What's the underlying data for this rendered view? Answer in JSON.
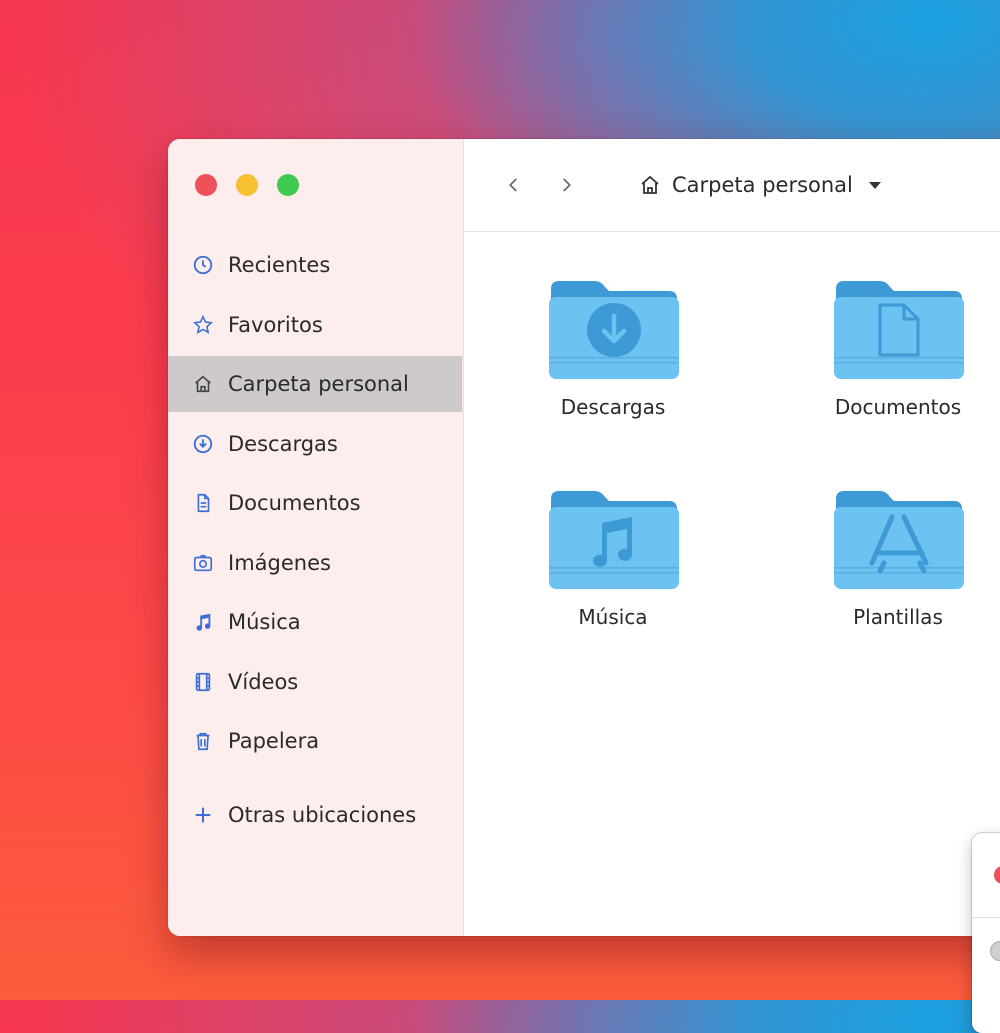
{
  "window": {
    "traffic_lights": [
      "close",
      "minimize",
      "maximize"
    ]
  },
  "sidebar": {
    "items": [
      {
        "label": "Recientes",
        "icon": "clock-icon"
      },
      {
        "label": "Favoritos",
        "icon": "star-icon"
      },
      {
        "label": "Carpeta personal",
        "icon": "home-icon",
        "active": true
      },
      {
        "label": "Descargas",
        "icon": "download-icon"
      },
      {
        "label": "Documentos",
        "icon": "document-icon"
      },
      {
        "label": "Imágenes",
        "icon": "camera-icon"
      },
      {
        "label": "Música",
        "icon": "music-note-icon"
      },
      {
        "label": "Vídeos",
        "icon": "film-icon"
      },
      {
        "label": "Papelera",
        "icon": "trash-icon"
      }
    ],
    "other_locations": {
      "label": "Otras ubicaciones",
      "icon": "plus-icon"
    }
  },
  "toolbar": {
    "back": "chevron-left-icon",
    "forward": "chevron-right-icon",
    "path_label": "Carpeta personal"
  },
  "folders": [
    {
      "label": "Descargas",
      "emblem": "download-icon"
    },
    {
      "label": "Documentos",
      "emblem": "document-icon"
    },
    {
      "label": "Música",
      "emblem": "music-note-icon"
    },
    {
      "label": "Plantillas",
      "emblem": "app-store-icon"
    }
  ],
  "colors": {
    "accent": "#3b6fd6",
    "folder": "#6cc2f0",
    "sidebar_bg": "#fdeeed",
    "active_row": "#cfcaca"
  }
}
